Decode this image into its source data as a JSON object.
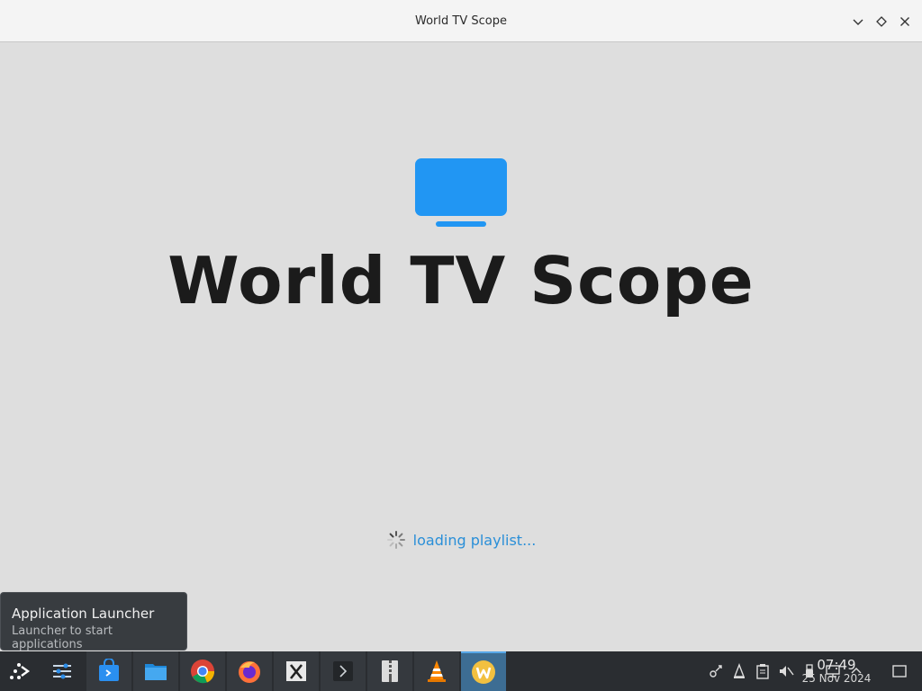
{
  "window": {
    "title": "World TV Scope",
    "controls": [
      {
        "name": "minimize-button",
        "icon": "chevron-down-icon"
      },
      {
        "name": "maximize-button",
        "icon": "diamond-icon"
      },
      {
        "name": "close-button",
        "icon": "close-icon"
      }
    ]
  },
  "app": {
    "icon": "tv-icon",
    "title": "World TV Scope",
    "loading_text": "loading playlist...",
    "accent_color": "#2196f3"
  },
  "tooltip": {
    "title": "Application Launcher",
    "subtitle": "Launcher to start applications"
  },
  "taskbar": {
    "launcher_icon": "kde-launcher-icon",
    "apps": [
      {
        "name": "system-settings",
        "icon": "settings-sliders-icon",
        "active": false
      },
      {
        "name": "discover-store",
        "icon": "store-icon",
        "active": false
      },
      {
        "name": "file-manager",
        "icon": "folder-icon",
        "active": false
      },
      {
        "name": "chrome",
        "icon": "chrome-icon",
        "active": false
      },
      {
        "name": "firefox",
        "icon": "firefox-icon",
        "active": false
      },
      {
        "name": "xtext-editor",
        "icon": "x-editor-icon",
        "active": false
      },
      {
        "name": "terminal",
        "icon": "terminal-icon",
        "active": false
      },
      {
        "name": "archive-manager",
        "icon": "archive-icon",
        "active": false
      },
      {
        "name": "vlc",
        "icon": "vlc-cone-icon",
        "active": false
      },
      {
        "name": "world-tv-scope",
        "icon": "w-app-icon",
        "active": true
      }
    ],
    "tray": [
      "network-icon",
      "vlc-tray-icon",
      "clipboard-icon",
      "volume-muted-icon",
      "usb-icon",
      "display-icon",
      "chevron-up-icon"
    ],
    "clock": {
      "time": "07:49",
      "date": "25 Nov 2024"
    }
  }
}
